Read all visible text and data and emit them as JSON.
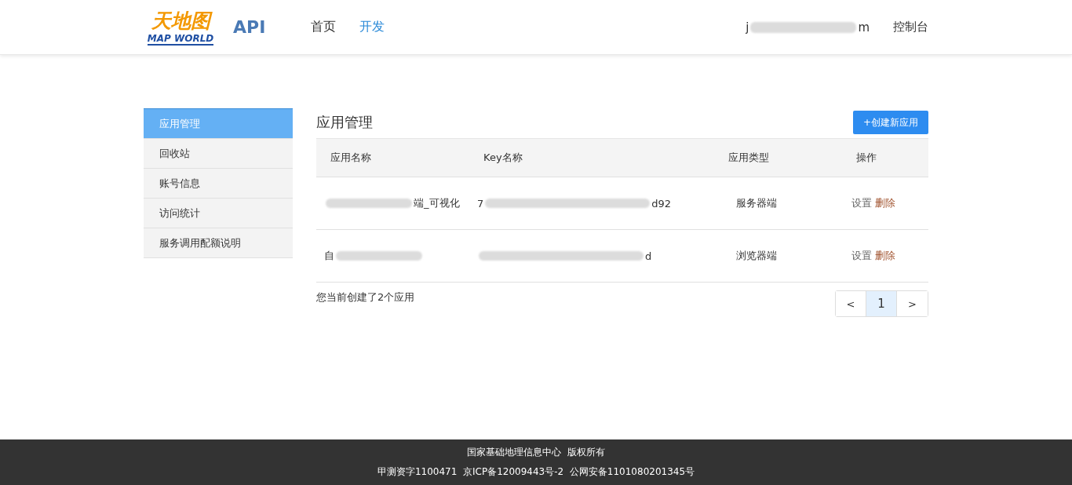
{
  "header": {
    "logo": {
      "name": "天地图",
      "subtitle": "MAP WORLD"
    },
    "product": "API",
    "nav": [
      {
        "label": "首页",
        "selected": false
      },
      {
        "label": "开发",
        "selected": true
      }
    ],
    "account": {
      "prefix": "j",
      "suffix": "m"
    },
    "console": "控制台"
  },
  "sidebar": {
    "items": [
      {
        "label": "应用管理",
        "selected": true
      },
      {
        "label": "回收站",
        "selected": false
      },
      {
        "label": "账号信息",
        "selected": false
      },
      {
        "label": "访问统计",
        "selected": false
      },
      {
        "label": "服务调用配额说明",
        "selected": false
      }
    ]
  },
  "main": {
    "title": "应用管理",
    "create_button": "+创建新应用",
    "table": {
      "columns": [
        "应用名称",
        "Key名称",
        "应用类型",
        "操作"
      ],
      "rows": [
        {
          "name": {
            "suffix": "端_可视化"
          },
          "key": {
            "prefix": "7",
            "suffix": "d92"
          },
          "type": "服务器端",
          "actions": [
            "设置",
            "删除"
          ]
        },
        {
          "name": {
            "prefix": "自"
          },
          "key": {
            "suffix": "d"
          },
          "type": "浏览器端",
          "actions": [
            "设置",
            "删除"
          ]
        }
      ]
    },
    "summary": "您当前创建了2个应用",
    "pagination": {
      "prev": "<",
      "pages": [
        {
          "label": "1",
          "selected": true
        }
      ],
      "next": ">"
    }
  },
  "footer": [
    "国家基础地理信息中心  版权所有",
    "甲测资字1100471  京ICP备12009443号-2  公网安备1101080201345号"
  ]
}
